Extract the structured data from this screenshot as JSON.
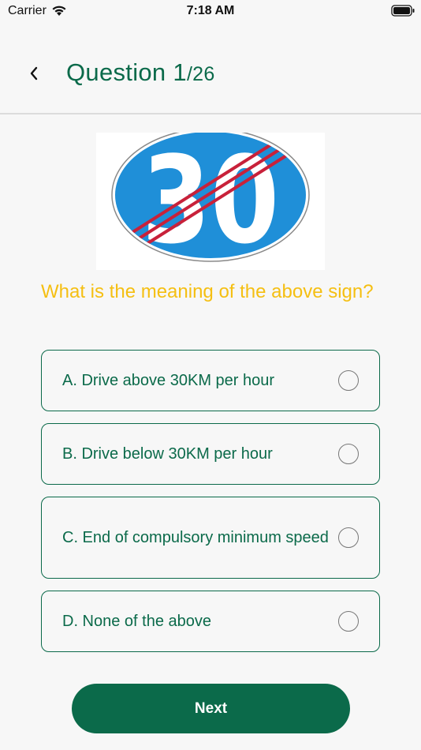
{
  "status_bar": {
    "carrier": "Carrier",
    "time": "7:18 AM"
  },
  "header": {
    "title_prefix": "Question ",
    "current": "1",
    "total": "/26"
  },
  "sign": {
    "number": "30",
    "colors": {
      "blue": "#1f8fd8",
      "stripe": "#c8213a"
    }
  },
  "question": "What is the meaning of the above sign?",
  "options": [
    {
      "label": "A. Drive above 30KM per hour"
    },
    {
      "label": "B. Drive below 30KM per hour"
    },
    {
      "label": "C. End of compulsory minimum speed"
    },
    {
      "label": "D. None of the above"
    }
  ],
  "next_label": "Next",
  "theme": {
    "primary": "#0b6a4a",
    "question": "#f5bf12"
  }
}
